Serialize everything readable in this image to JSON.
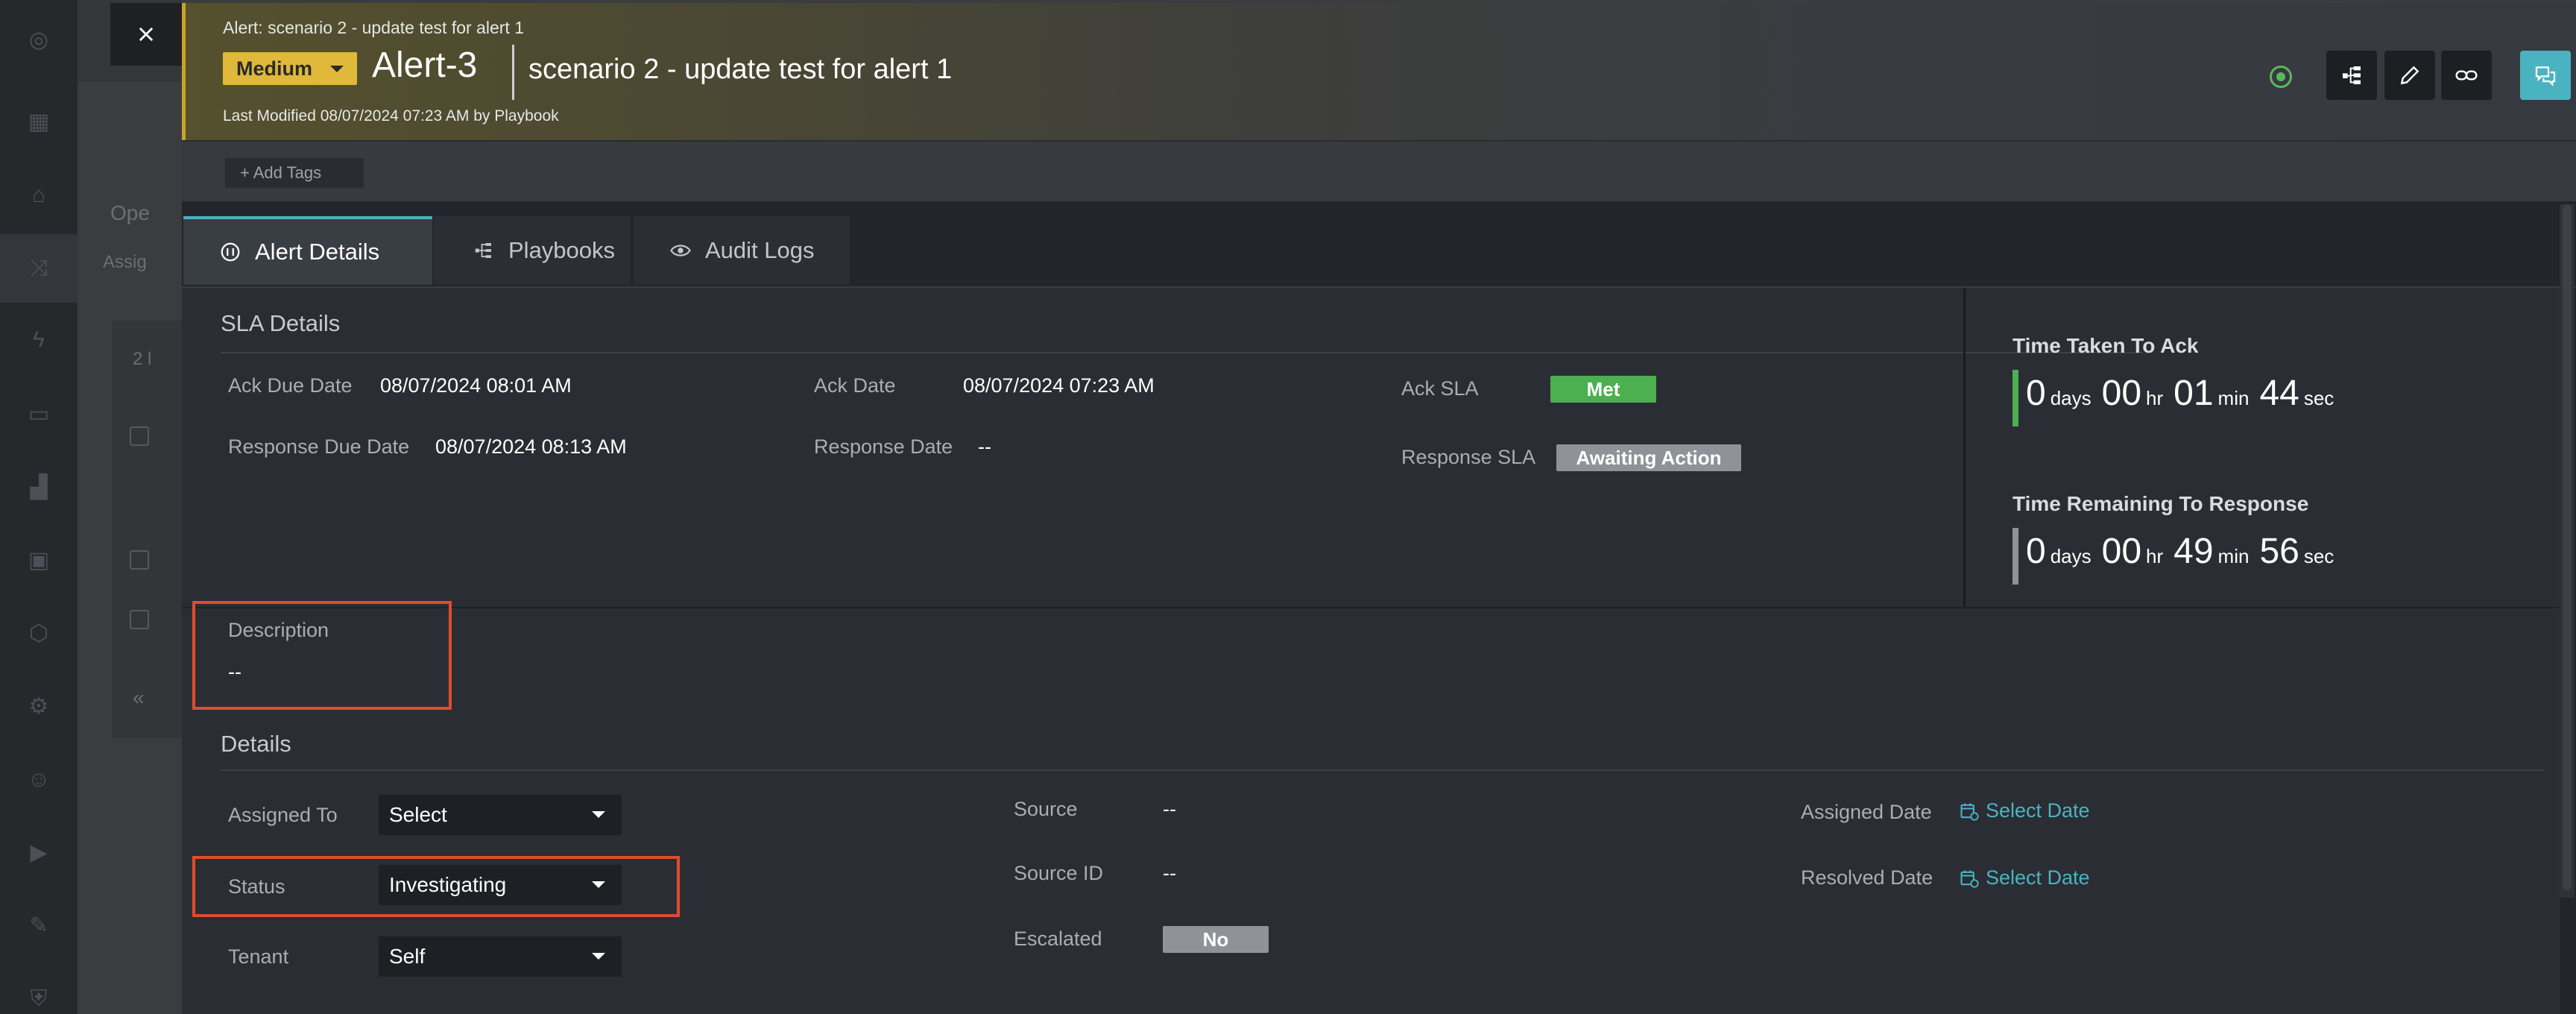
{
  "background": {
    "title_fragment": "Ope",
    "tab_fragment": "Assig",
    "count_fragment": "2 l",
    "collapse_glyph": "«"
  },
  "close": {
    "icon": "close-icon"
  },
  "header": {
    "subtitle": "Alert: scenario 2 - update test for alert 1",
    "severity": "Medium",
    "alert_id": "Alert-3",
    "title": "scenario 2 - update test for alert 1",
    "last_modified": "Last Modified 08/07/2024 07:23 AM by Playbook",
    "accent_color": "#c9a227",
    "icons": [
      "status-icon",
      "playbook-tree-icon",
      "edit-icon",
      "link-icon",
      "comments-icon"
    ]
  },
  "tags": {
    "add_label": "+ Add Tags"
  },
  "tabs": [
    {
      "label": "Alert Details",
      "icon": "alert-details-icon",
      "active": true
    },
    {
      "label": "Playbooks",
      "icon": "playbooks-icon",
      "active": false
    },
    {
      "label": "Audit Logs",
      "icon": "eye-icon",
      "active": false
    }
  ],
  "sla": {
    "title": "SLA Details",
    "ack_due_label": "Ack Due Date",
    "ack_due_value": "08/07/2024 08:01 AM",
    "ack_date_label": "Ack Date",
    "ack_date_value": "08/07/2024 07:23 AM",
    "ack_sla_label": "Ack SLA",
    "ack_sla_value": "Met",
    "response_due_label": "Response Due Date",
    "response_due_value": "08/07/2024 08:13 AM",
    "response_date_label": "Response Date",
    "response_date_value": "--",
    "response_sla_label": "Response SLA",
    "response_sla_value": "Awaiting Action"
  },
  "timers": {
    "ack": {
      "title": "Time Taken To Ack",
      "days": "0",
      "days_unit": "days",
      "hours": "00",
      "hours_unit": "hr",
      "mins": "01",
      "mins_unit": "min",
      "secs": "44",
      "secs_unit": "sec",
      "bar_color": "#4caf50"
    },
    "response": {
      "title": "Time Remaining To Response",
      "days": "0",
      "days_unit": "days",
      "hours": "00",
      "hours_unit": "hr",
      "mins": "49",
      "mins_unit": "min",
      "secs": "56",
      "secs_unit": "sec",
      "bar_color": "#8f9297"
    }
  },
  "description": {
    "label": "Description",
    "value": "--"
  },
  "details": {
    "title": "Details",
    "assigned_to_label": "Assigned To",
    "assigned_to_value": "Select",
    "status_label": "Status",
    "status_value": "Investigating",
    "tenant_label": "Tenant",
    "tenant_value": "Self",
    "source_label": "Source",
    "source_value": "--",
    "source_id_label": "Source ID",
    "source_id_value": "--",
    "escalated_label": "Escalated",
    "escalated_value": "No",
    "assigned_date_label": "Assigned Date",
    "assigned_date_value": "Select Date",
    "resolved_date_label": "Resolved Date",
    "resolved_date_value": "Select Date"
  }
}
